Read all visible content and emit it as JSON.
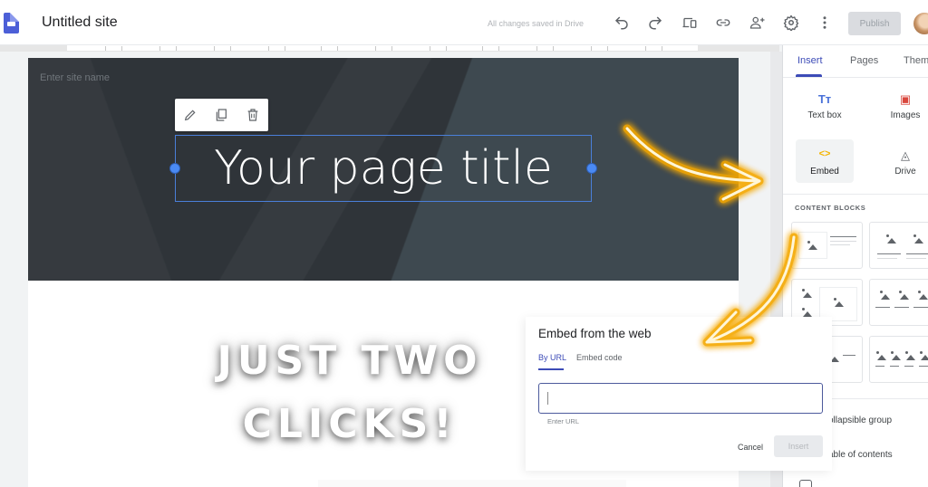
{
  "app": {
    "title": "Untitled site",
    "save_status": "All changes saved in Drive",
    "publish_label": "Publish",
    "toolbar_icons": [
      "undo-icon",
      "redo-icon",
      "preview-devices-icon",
      "link-icon",
      "share-add-person-icon",
      "settings-gear-icon",
      "more-vert-icon"
    ]
  },
  "canvas": {
    "site_name_placeholder": "Enter site name",
    "page_title": "Your page title",
    "element_toolbar": [
      "edit-pencil-icon",
      "duplicate-icon",
      "delete-trash-icon"
    ],
    "overlay_caption_line1": "JUST TWO",
    "overlay_caption_line2": "CLICKS!"
  },
  "panel": {
    "tabs": [
      {
        "label": "Insert",
        "active": true
      },
      {
        "label": "Pages",
        "active": false
      },
      {
        "label": "Them",
        "active": false
      }
    ],
    "insert_items": [
      {
        "label": "Text box",
        "icon": "Tт",
        "icon_name": "text-box-icon",
        "color": "#4a72d9"
      },
      {
        "label": "Images",
        "icon": "▣",
        "icon_name": "images-icon",
        "color": "#d9473d"
      },
      {
        "label": "Embed",
        "icon": "<>",
        "icon_name": "embed-code-icon",
        "color": "#f4b400",
        "selected": true
      },
      {
        "label": "Drive",
        "icon": "◬",
        "icon_name": "drive-icon",
        "color": "#5f6368"
      }
    ],
    "content_blocks_heading": "CONTENT BLOCKS",
    "list_items": [
      {
        "label": "ollapsible group"
      },
      {
        "label": "able of contents"
      }
    ]
  },
  "dialog": {
    "title": "Embed from the web",
    "tabs": [
      {
        "label": "By URL",
        "active": true
      },
      {
        "label": "Embed code",
        "active": false
      }
    ],
    "input_value": "",
    "input_helper": "Enter URL",
    "cancel_label": "Cancel",
    "insert_label": "Insert"
  },
  "colors": {
    "accent": "#3c4bb7",
    "selection_blue": "#4a7fd9",
    "hero_bg": "#2f3439",
    "arrow_glow": "#f5a800"
  }
}
